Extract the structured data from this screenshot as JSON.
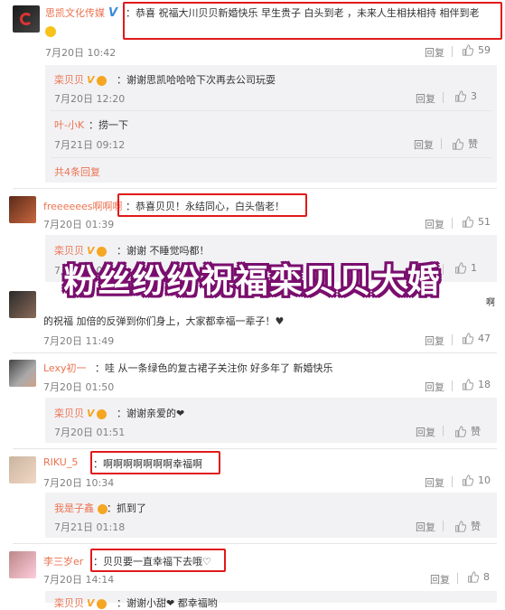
{
  "overlay_title": "粉丝纷纷祝福栾贝贝大婚",
  "comments": [
    {
      "user": "思凯文化传媒",
      "text_line1": "：恭喜 祝福大川贝贝新婚快乐 早生贵子 白头到老 ，未来人生相扶相持 相伴到老",
      "time": "7月20日 10:42",
      "reply_label": "回复",
      "likes": "59"
    },
    {
      "user": "栾贝贝",
      "text": "：谢谢思凯哈哈哈下次再去公司玩耍",
      "time": "7月20日 12:20",
      "reply_label": "回复",
      "likes": "3"
    },
    {
      "user": "叶-小K",
      "text": "：捞一下",
      "time": "7月21日 09:12",
      "reply_label": "回复",
      "likes": "赞"
    },
    {
      "more": "共4条回复"
    },
    {
      "user": "freeeeees啊啊啊",
      "text": "：恭喜贝贝！永结同心，白头偕老！",
      "time": "7月20日 01:39",
      "reply_label": "回复",
      "likes": "51"
    },
    {
      "user": "栾贝贝",
      "text": "：谢谢 不睡觉吗都！",
      "time": "7月20日 01:42",
      "reply_label": "回复",
      "likes": "1"
    },
    {
      "text_line1": "的祝福 加倍的反弹到你们身上，大家都幸福一辈子！♥",
      "text_tail": "啊",
      "time": "7月20日 11:49",
      "reply_label": "回复",
      "likes": "47"
    },
    {
      "user": "Lexy初一",
      "text": "：哇 从一条绿色的复古裙子关注你 好多年了 新婚快乐",
      "time": "7月20日 01:50",
      "reply_label": "回复",
      "likes": "18"
    },
    {
      "user": "栾贝贝",
      "text": "：谢谢亲爱的❤",
      "time": "7月20日 01:51",
      "reply_label": "回复",
      "likes": "赞"
    },
    {
      "user": "RIKU_5",
      "text": "：啊啊啊啊啊啊啊幸福啊",
      "time": "7月20日 10:34",
      "reply_label": "回复",
      "likes": "10"
    },
    {
      "user": "我是子鑫",
      "text": "：抓到了",
      "time": "7月21日 01:18",
      "reply_label": "回复",
      "likes": "赞"
    },
    {
      "user": "李三岁er",
      "text": "：贝贝要一直幸福下去哦♡",
      "time": "7月20日 14:14",
      "reply_label": "回复",
      "likes": "8"
    },
    {
      "user": "栾贝贝",
      "text": "：谢谢小甜❤ 都幸福哟"
    }
  ]
}
